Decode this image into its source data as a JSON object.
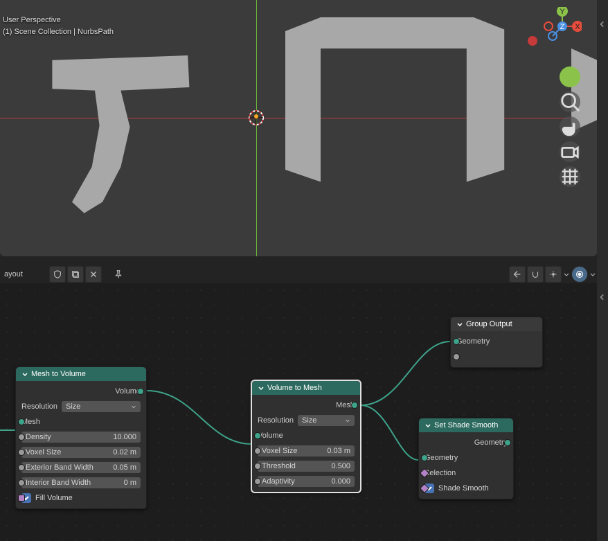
{
  "viewport": {
    "perspective_label": "User Perspective",
    "context_label": "(1) Scene Collection | NurbsPath"
  },
  "gizmo": {
    "axes": {
      "x": "X",
      "y": "Y",
      "z": "Z"
    }
  },
  "node_editor_header": {
    "layout_label": "ayout"
  },
  "nodes": {
    "mesh_to_volume": {
      "title": "Mesh to Volume",
      "out_volume": "Volume",
      "resolution_label": "Resolution",
      "resolution_value": "Size",
      "in_mesh": "Mesh",
      "density_label": "Density",
      "density_value": "10.000",
      "voxel_label": "Voxel Size",
      "voxel_value": "0.02 m",
      "ext_band_label": "Exterior Band Width",
      "ext_band_value": "0.05 m",
      "int_band_label": "Interior Band Width",
      "int_band_value": "0 m",
      "fill_label": "Fill Volume"
    },
    "volume_to_mesh": {
      "title": "Volume to Mesh",
      "out_mesh": "Mesh",
      "resolution_label": "Resolution",
      "resolution_value": "Size",
      "in_volume": "Volume",
      "voxel_label": "Voxel Size",
      "voxel_value": "0.03 m",
      "threshold_label": "Threshold",
      "threshold_value": "0.500",
      "adaptivity_label": "Adaptivity",
      "adaptivity_value": "0.000"
    },
    "set_shade_smooth": {
      "title": "Set Shade Smooth",
      "out_geometry": "Geometry",
      "in_geometry": "Geometry",
      "in_selection": "Selection",
      "shade_label": "Shade Smooth"
    },
    "group_output": {
      "title": "Group Output",
      "in_geometry": "Geometry"
    }
  }
}
